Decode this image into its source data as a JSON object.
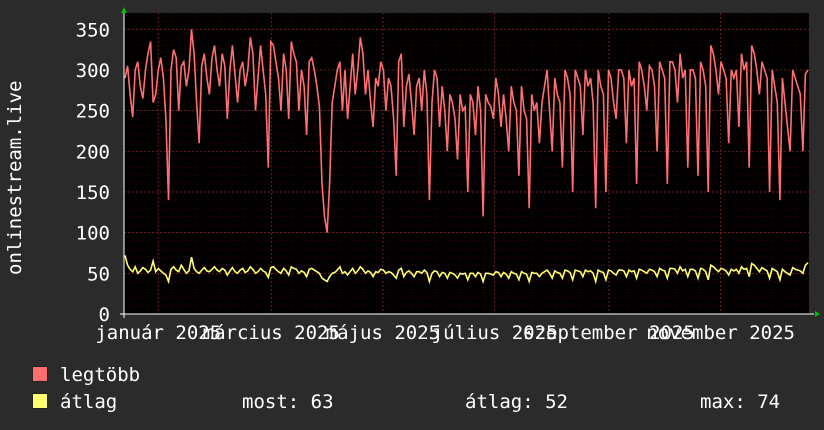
{
  "colors": {
    "background": "#2b2b2b",
    "plot": "#000000",
    "grid": "#5a0000",
    "major_grid": "#8a2b2b",
    "axis": "#ffffff",
    "max_line": "#ff6f6f",
    "avg_line": "#ffff6f",
    "arrow": "#00c000"
  },
  "chart_data": {
    "type": "line",
    "ylabel": "onlinestream.live",
    "ylim": [
      0,
      370
    ],
    "y_ticks": [
      0,
      50,
      100,
      150,
      200,
      250,
      300,
      350
    ],
    "x_tick_labels": [
      "január 2025",
      "március 2025",
      "május 2025",
      "július 2025",
      "szeptember 2025",
      "november 2025"
    ],
    "x_tick_positions": [
      0.05,
      0.215,
      0.378,
      0.541,
      0.708,
      0.871
    ],
    "series": [
      {
        "name": "legtöbb",
        "color": "#ff6f6f",
        "values": [
          290,
          305,
          270,
          242,
          300,
          310,
          280,
          265,
          300,
          320,
          335,
          260,
          270,
          300,
          315,
          290,
          240,
          140,
          300,
          325,
          315,
          250,
          305,
          310,
          280,
          300,
          350,
          320,
          260,
          210,
          305,
          320,
          290,
          270,
          315,
          330,
          300,
          280,
          320,
          305,
          240,
          300,
          330,
          295,
          260,
          300,
          310,
          280,
          300,
          340,
          320,
          250,
          290,
          330,
          300,
          270,
          180,
          335,
          330,
          310,
          290,
          250,
          320,
          300,
          240,
          335,
          320,
          310,
          250,
          300,
          280,
          220,
          310,
          315,
          300,
          280,
          255,
          160,
          120,
          100,
          160,
          260,
          280,
          300,
          310,
          250,
          300,
          240,
          280,
          320,
          270,
          300,
          340,
          320,
          270,
          300,
          260,
          230,
          290,
          280,
          310,
          300,
          250,
          290,
          280,
          240,
          170,
          310,
          320,
          230,
          280,
          295,
          260,
          220,
          280,
          290,
          250,
          300,
          270,
          140,
          260,
          300,
          290,
          230,
          280,
          250,
          200,
          270,
          260,
          240,
          190,
          270,
          250,
          255,
          150,
          270,
          260,
          220,
          280,
          250,
          120,
          270,
          260,
          255,
          240,
          290,
          270,
          230,
          270,
          240,
          200,
          280,
          260,
          250,
          170,
          280,
          250,
          240,
          130,
          270,
          250,
          260,
          210,
          260,
          280,
          300,
          250,
          200,
          290,
          270,
          260,
          180,
          300,
          290,
          270,
          150,
          300,
          290,
          280,
          220,
          300,
          280,
          290,
          260,
          130,
          300,
          280,
          270,
          150,
          300,
          290,
          260,
          240,
          300,
          300,
          290,
          210,
          300,
          280,
          290,
          160,
          310,
          300,
          280,
          250,
          305,
          300,
          280,
          200,
          310,
          300,
          290,
          160,
          310,
          310,
          300,
          260,
          320,
          290,
          300,
          180,
          300,
          300,
          290,
          170,
          310,
          300,
          280,
          150,
          330,
          320,
          300,
          270,
          310,
          300,
          290,
          210,
          300,
          290,
          300,
          230,
          320,
          300,
          310,
          180,
          330,
          320,
          300,
          270,
          310,
          300,
          290,
          150,
          300,
          280,
          260,
          140,
          290,
          260,
          230,
          200,
          300,
          290,
          280,
          270,
          200,
          295,
          300
        ]
      },
      {
        "name": "átlag",
        "color": "#ffff6f",
        "values": [
          72,
          60,
          55,
          52,
          58,
          50,
          53,
          57,
          55,
          51,
          54,
          65,
          52,
          56,
          53,
          50,
          48,
          40,
          55,
          58,
          54,
          52,
          60,
          55,
          50,
          53,
          70,
          56,
          52,
          50,
          54,
          57,
          53,
          52,
          55,
          58,
          54,
          52,
          56,
          54,
          48,
          53,
          57,
          52,
          50,
          54,
          56,
          51,
          53,
          58,
          55,
          50,
          52,
          56,
          53,
          51,
          45,
          57,
          58,
          55,
          52,
          50,
          56,
          53,
          48,
          58,
          56,
          55,
          50,
          53,
          51,
          46,
          55,
          56,
          54,
          52,
          50,
          44,
          42,
          40,
          46,
          50,
          51,
          54,
          58,
          50,
          52,
          48,
          52,
          56,
          50,
          53,
          58,
          55,
          50,
          53,
          51,
          46,
          52,
          51,
          55,
          54,
          50,
          52,
          51,
          48,
          44,
          54,
          56,
          46,
          51,
          53,
          50,
          46,
          52,
          52,
          50,
          54,
          51,
          40,
          50,
          53,
          52,
          46,
          51,
          50,
          44,
          51,
          50,
          48,
          44,
          50,
          49,
          50,
          42,
          50,
          50,
          46,
          51,
          49,
          40,
          50,
          50,
          49,
          48,
          52,
          51,
          46,
          51,
          49,
          44,
          52,
          50,
          49,
          42,
          52,
          50,
          49,
          40,
          51,
          50,
          50,
          46,
          50,
          52,
          54,
          50,
          44,
          53,
          51,
          50,
          44,
          54,
          53,
          51,
          42,
          54,
          53,
          52,
          46,
          54,
          52,
          53,
          50,
          40,
          54,
          52,
          51,
          42,
          54,
          53,
          50,
          48,
          54,
          54,
          53,
          46,
          54,
          52,
          53,
          44,
          55,
          54,
          52,
          50,
          55,
          54,
          52,
          46,
          56,
          54,
          53,
          44,
          56,
          56,
          55,
          50,
          58,
          53,
          55,
          46,
          55,
          55,
          53,
          44,
          56,
          55,
          52,
          42,
          60,
          58,
          55,
          52,
          56,
          55,
          53,
          48,
          55,
          53,
          55,
          50,
          58,
          55,
          56,
          46,
          62,
          60,
          56,
          52,
          57,
          55,
          53,
          44,
          56,
          54,
          52,
          42,
          55,
          52,
          50,
          48,
          57,
          55,
          54,
          53,
          50,
          60,
          63
        ]
      }
    ]
  },
  "legend": {
    "max_label": "legtöbb",
    "avg_label": "átlag",
    "current": "most: 63",
    "average": "átlag: 52",
    "maximum": "max: 74"
  }
}
